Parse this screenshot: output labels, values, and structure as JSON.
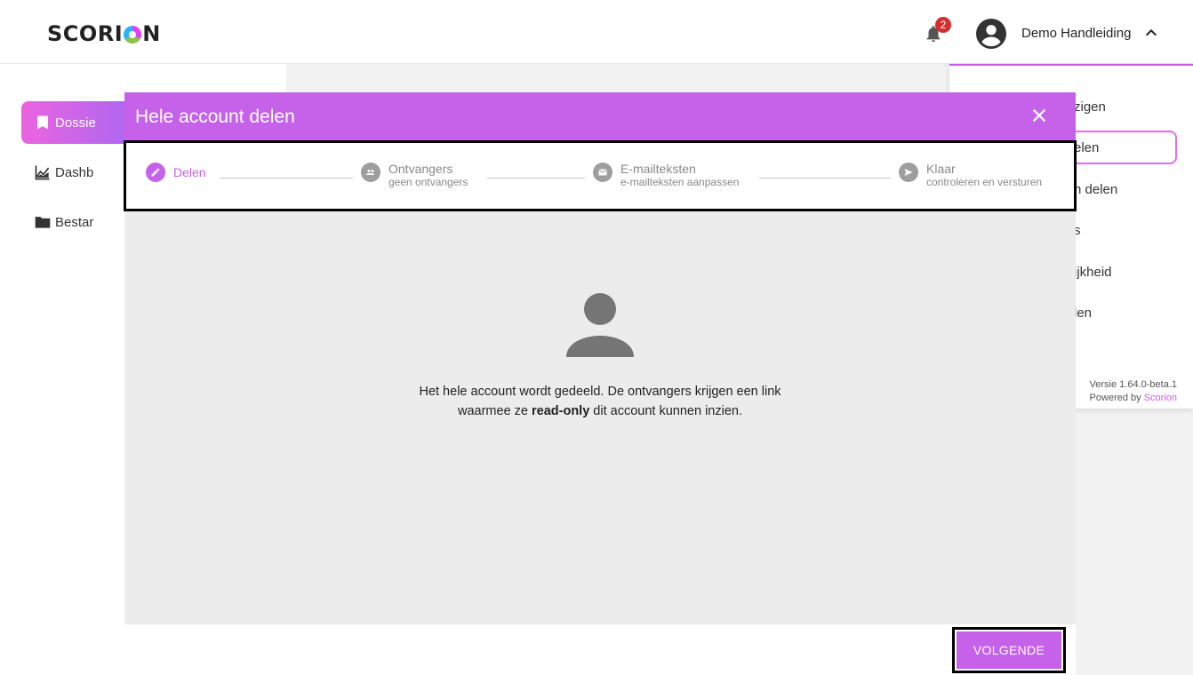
{
  "app": {
    "logo_text_1": "SCORI",
    "logo_text_2": "N"
  },
  "header": {
    "notification_count": "2",
    "user_name": "Demo Handleiding"
  },
  "sidebar": {
    "items": [
      {
        "label": "Dossie",
        "icon": "bookmark-icon",
        "active": true
      },
      {
        "label": "Dashb",
        "icon": "chart-icon",
        "active": false
      },
      {
        "label": "Bestar",
        "icon": "folder-icon",
        "active": false
      }
    ]
  },
  "right_menu": {
    "items": [
      "zigen",
      "elen",
      "n delen",
      "s",
      "ijkheid",
      "len"
    ],
    "version": "Versie 1.64.0-beta.1",
    "powered_by": "Powered by",
    "brand": "Scorion"
  },
  "modal": {
    "title": "Hele account delen",
    "steps": [
      {
        "label": "Delen",
        "sub": "",
        "icon": "pencil-icon"
      },
      {
        "label": "Ontvangers",
        "sub": "geen ontvangers",
        "icon": "people-icon"
      },
      {
        "label": "E-mailteksten",
        "sub": "e-mailteksten aanpassen",
        "icon": "mail-icon"
      },
      {
        "label": "Klaar",
        "sub": "controleren en versturen",
        "icon": "send-icon"
      }
    ],
    "message_1": "Het hele account wordt gedeeld. De ontvangers krijgen een link",
    "message_2a": "waarmee ze ",
    "message_bold": "read-only",
    "message_2b": " dit account kunnen inzien.",
    "next_button": "VOLGENDE"
  },
  "colors": {
    "accent": "#c562e9",
    "badge": "#d32f2f"
  }
}
